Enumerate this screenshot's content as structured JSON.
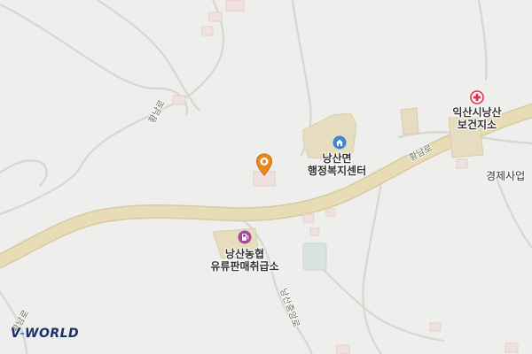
{
  "map": {
    "labels": {
      "admin_center": [
        "낭산면",
        "행정복지센터"
      ],
      "health_center": [
        "익산시낭산",
        "보건지소"
      ],
      "coop_gas": [
        "낭산농협",
        "유류판매취급소"
      ],
      "partial_office": "경제사업"
    },
    "roads": {
      "hwangnam_upper": "황남로",
      "hwangnam_main": "황남로",
      "hwangnam_lower": "황남로",
      "nangsan_jungang": "낭산중앙로"
    },
    "icons": {
      "admin_center": "home-icon",
      "health_center": "hospital-cross-icon",
      "coop_gas": "gas-station-icon",
      "selected_marker": "location-pin-icon"
    },
    "colors": {
      "background": "#eeeeec",
      "road_main": "#e7dcb6",
      "road_main_edge": "#d8caa0",
      "road_minor": "#ffffff",
      "building": "#e6dcc0",
      "marker": "#e98a1e",
      "hospital": "#e0314a",
      "home": "#3d86d6",
      "gas": "#a5489a"
    }
  },
  "logo": {
    "prefix": "V",
    "dash": "-",
    "text": "WORLD"
  }
}
